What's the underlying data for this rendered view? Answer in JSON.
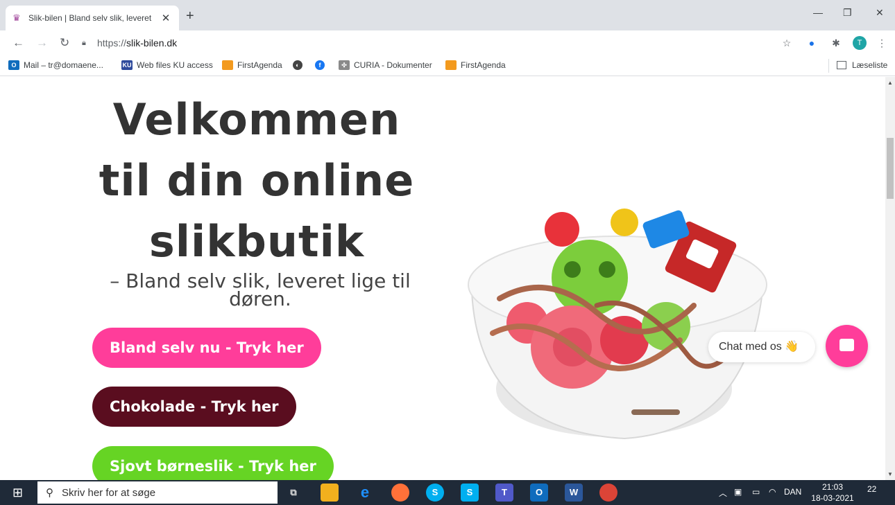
{
  "browser": {
    "tab_title": "Slik-bilen | Bland selv slik, leveret",
    "tab_close": "✕",
    "new_tab": "+",
    "url_scheme": "https://",
    "url_host": "slik-bilen.dk",
    "profile_initial": "T",
    "window_controls": [
      "—",
      "❐",
      "✕"
    ]
  },
  "bookmarks": [
    {
      "label": "Mail – tr@domaene...",
      "icon": "outlook-icon",
      "color": "#0f6cbd"
    },
    {
      "label": "Web files KU access",
      "icon": "ku-icon",
      "color": "#2e4a9c"
    },
    {
      "label": "FirstAgenda",
      "icon": "firstagenda-icon",
      "color": "#f39a1e"
    },
    {
      "label": "",
      "icon": "globe-icon",
      "color": "#444444"
    },
    {
      "label": "",
      "icon": "facebook-icon",
      "color": "#1877f2"
    },
    {
      "label": "CURIA - Dokumenter",
      "icon": "curia-icon",
      "color": "#8a8a8a"
    },
    {
      "label": "FirstAgenda",
      "icon": "firstagenda-icon",
      "color": "#f39a1e"
    }
  ],
  "reading_list": "Læseliste",
  "hero": {
    "headline": "Velkommen\ntil din online\nslikbutik",
    "subheadline": "– Bland selv slik, leveret lige til døren."
  },
  "buttons": {
    "mix_label": "Bland selv nu - Tryk her",
    "chocolate_label": "Chokolade - Tryk her",
    "kids_label": "Sjovt børneslik - Tryk her"
  },
  "chat": {
    "label": "Chat med os 👋"
  },
  "taskbar": {
    "search_placeholder": "Skriv her for at søge",
    "language": "DAN",
    "time": "21:03",
    "date": "18-03-2021",
    "notifications": "22"
  },
  "colors": {
    "pink": "#ff3d9a",
    "chocolate": "#5a0d1f",
    "green": "#66d424"
  }
}
